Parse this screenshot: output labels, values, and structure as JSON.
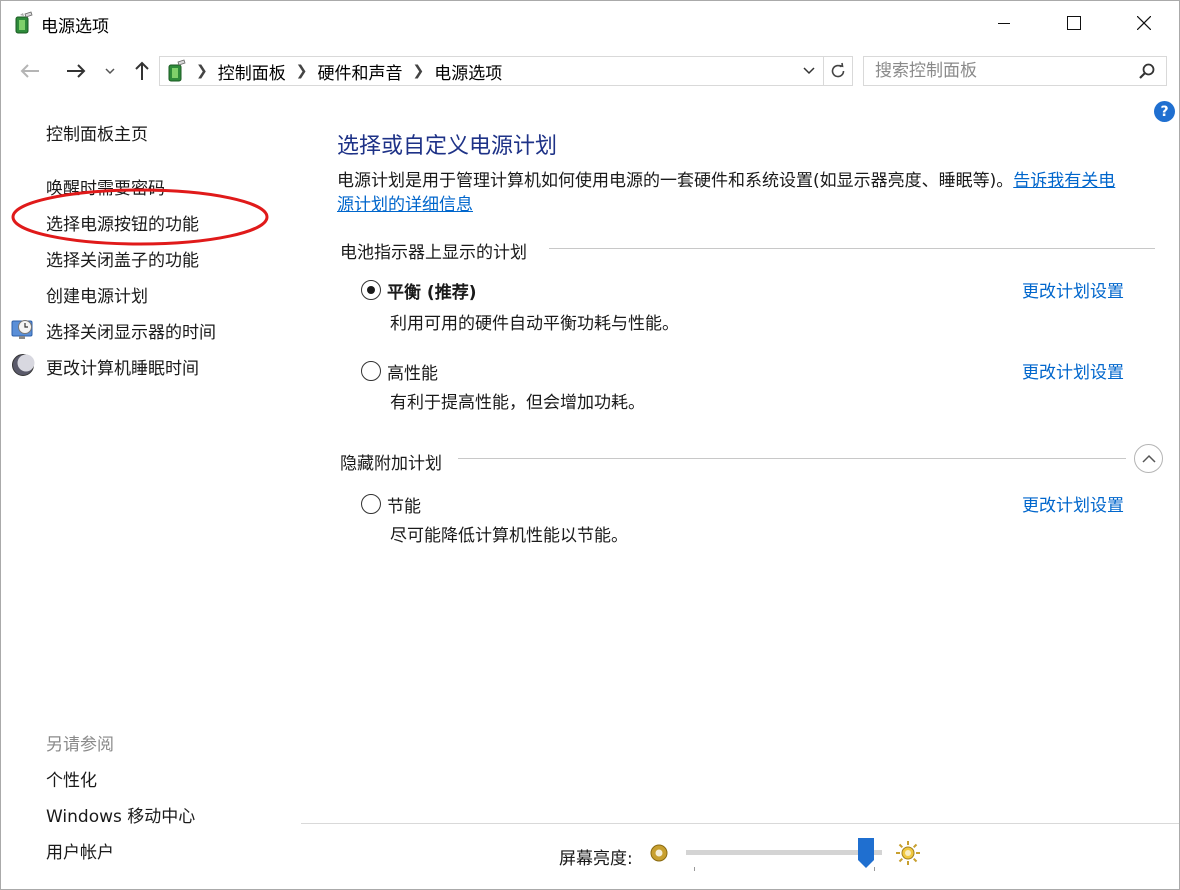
{
  "window": {
    "title": "电源选项",
    "controls": [
      "minimize",
      "maximize",
      "close"
    ]
  },
  "address_bar": {
    "breadcrumbs": [
      "控制面板",
      "硬件和声音",
      "电源选项"
    ]
  },
  "search": {
    "placeholder": "搜索控制面板"
  },
  "help_label": "?",
  "sidebar": {
    "home": "控制面板主页",
    "items": [
      {
        "label": "唤醒时需要密码",
        "icon": null
      },
      {
        "label": "选择电源按钮的功能",
        "icon": null,
        "highlighted": true
      },
      {
        "label": "选择关闭盖子的功能",
        "icon": null
      },
      {
        "label": "创建电源计划",
        "icon": null
      },
      {
        "label": "选择关闭显示器的时间",
        "icon": "monitor-clock-icon"
      },
      {
        "label": "更改计算机睡眠时间",
        "icon": "moon-icon"
      }
    ],
    "see_also_header": "另请参阅",
    "see_also": [
      "个性化",
      "Windows 移动中心",
      "用户帐户"
    ]
  },
  "main": {
    "title": "选择或自定义电源计划",
    "description": "电源计划是用于管理计算机如何使用电源的一套硬件和系统设置(如显示器亮度、睡眠等)。",
    "description_link_line1": "告诉我有关电",
    "description_link_line2": "源计划的详细信息",
    "battery_group_header": "电池指示器上显示的计划",
    "hidden_group_header": "隐藏附加计划",
    "plans": [
      {
        "name": "平衡 (推荐)",
        "description": "利用可用的硬件自动平衡功耗与性能。",
        "selected": true,
        "link": "更改计划设置"
      },
      {
        "name": "高性能",
        "description": "有利于提高性能，但会增加功耗。",
        "selected": false,
        "link": "更改计划设置"
      },
      {
        "name": "节能",
        "description": "尽可能降低计算机性能以节能。",
        "selected": false,
        "link": "更改计划设置"
      }
    ]
  },
  "brightness": {
    "label": "屏幕亮度:",
    "level_percent": 96
  },
  "colors": {
    "title_blue": "#1e3287",
    "link_blue": "#0066cc",
    "highlight_red": "#e01a1a",
    "slider_blue": "#1f6fd0"
  }
}
